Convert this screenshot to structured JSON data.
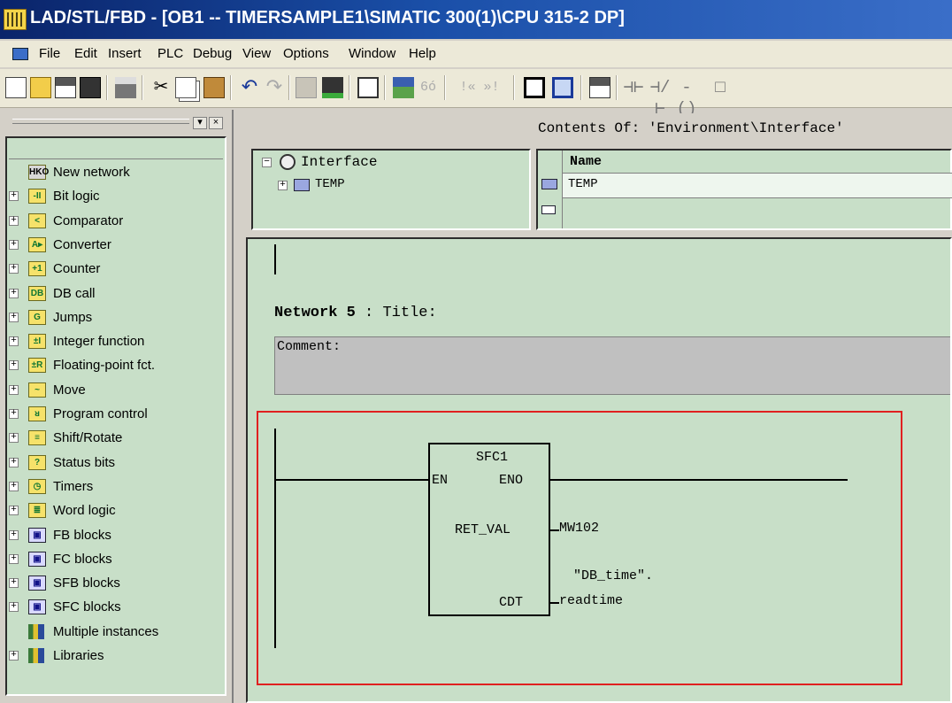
{
  "window": {
    "title": "LAD/STL/FBD  - [OB1 -- TIMERSAMPLE1\\SIMATIC 300(1)\\CPU 315-2 DP]"
  },
  "menu": [
    "File",
    "Edit",
    "Insert",
    "PLC",
    "Debug",
    "View",
    "Options",
    "Window",
    "Help"
  ],
  "toolbar": {
    "icons": [
      "new-icon",
      "open-icon",
      "network-icon",
      "save-icon",
      "print-icon",
      "cut-icon",
      "copy-icon",
      "paste-icon",
      "undo-icon",
      "redo-icon",
      "download-icon",
      "load-icon",
      "tag-icon",
      "nodes-icon",
      "toggle-icon",
      "prev-next-icon",
      "overview-icon",
      "details-icon",
      "new-network-icon",
      "contact-icon",
      "nc-contact-icon",
      "coil-icon",
      "box-icon"
    ],
    "text_buttons": {
      "prev_next": "!« »!",
      "wildcard": "6ó"
    }
  },
  "catalog": {
    "items": [
      {
        "label": "New network",
        "icon": "HKO",
        "expandable": false
      },
      {
        "label": "Bit logic",
        "icon": "-II",
        "expandable": true
      },
      {
        "label": "Comparator",
        "icon": "<",
        "expandable": true
      },
      {
        "label": "Converter",
        "icon": "A▸",
        "expandable": true
      },
      {
        "label": "Counter",
        "icon": "+1",
        "expandable": true
      },
      {
        "label": "DB call",
        "icon": "DB",
        "expandable": true
      },
      {
        "label": "Jumps",
        "icon": "G",
        "expandable": true
      },
      {
        "label": "Integer function",
        "icon": "±I",
        "expandable": true
      },
      {
        "label": "Floating-point fct.",
        "icon": "±R",
        "expandable": true
      },
      {
        "label": "Move",
        "icon": "~",
        "expandable": true
      },
      {
        "label": "Program control",
        "icon": "ᴚ",
        "expandable": true
      },
      {
        "label": "Shift/Rotate",
        "icon": "≡",
        "expandable": true
      },
      {
        "label": "Status bits",
        "icon": "?",
        "expandable": true
      },
      {
        "label": "Timers",
        "icon": "◷",
        "expandable": true
      },
      {
        "label": "Word logic",
        "icon": "≣",
        "expandable": true
      },
      {
        "label": "FB blocks",
        "icon": "▣",
        "expandable": true
      },
      {
        "label": "FC blocks",
        "icon": "▣",
        "expandable": true
      },
      {
        "label": "SFB blocks",
        "icon": "▣",
        "expandable": true
      },
      {
        "label": "SFC blocks",
        "icon": "▣",
        "expandable": true
      },
      {
        "label": "Multiple instances",
        "icon": "lib",
        "expandable": false
      },
      {
        "label": "Libraries",
        "icon": "lib",
        "expandable": true
      }
    ]
  },
  "interface": {
    "contents_of": "Contents Of: 'Environment\\Interface'",
    "tree_root": "Interface",
    "tree_child": "TEMP",
    "table_header": "Name",
    "table_row": "TEMP"
  },
  "network": {
    "title_label": "Network 5",
    "title_sep": " : ",
    "title_text": "Title:",
    "comment_label": "Comment:",
    "block": {
      "name": "SFC1",
      "pin_en": "EN",
      "pin_eno": "ENO",
      "pin_ret": "RET_VAL",
      "pin_cdt": "CDT",
      "ret_operand": "MW102",
      "cdt_operand_line1": "\"DB_time\".",
      "cdt_operand_line2": "readtime"
    }
  },
  "colors": {
    "editor_bg": "#c8dfc8",
    "comment_bg": "#c0c0c0",
    "selection_border": "#e02020",
    "titlebar": "#0a246a"
  }
}
